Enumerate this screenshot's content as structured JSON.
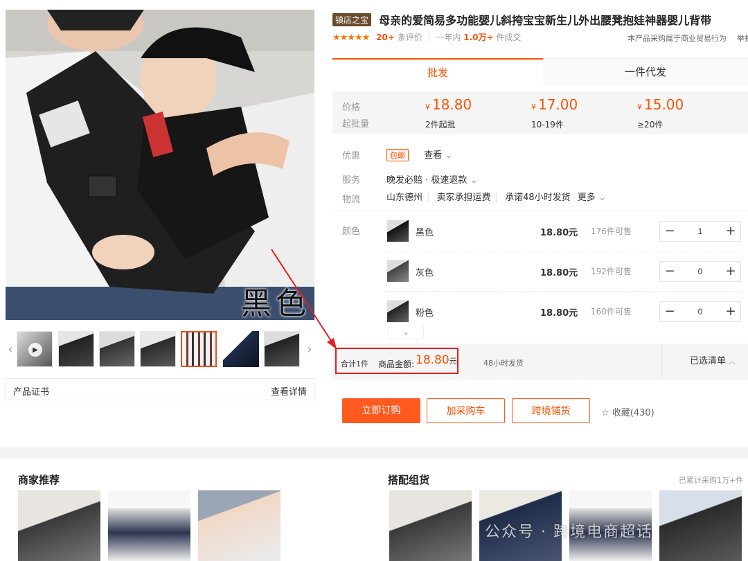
{
  "gallery": {
    "main_caption": "黑色",
    "prev_icon": "chevron-left-icon",
    "next_icon": "chevron-right-icon"
  },
  "certificate": {
    "label": "产品证书",
    "link": "查看详情"
  },
  "product": {
    "store_badge": "镇店之宝",
    "title": "母亲的爱简易多功能婴儿斜挎宝宝新生儿外出腰凳抱娃神器婴儿背带",
    "stars": "★★★★★",
    "review_count": "20+",
    "review_label": "条评价",
    "sales_prefix": "一年内",
    "sales_count": "1.0万+",
    "sales_label": "件成交",
    "trade_note": "本产品采购属于商业贸易行为",
    "report": "举报"
  },
  "tabs": [
    {
      "label": "批发"
    },
    {
      "label": "一件代发"
    }
  ],
  "pricing": {
    "price_label": "价格",
    "moq_label": "起批量",
    "currency": "¥",
    "tiers": [
      {
        "price": "18.80",
        "qty": "2件起批"
      },
      {
        "price": "17.00",
        "qty": "10-19件"
      },
      {
        "price": "15.00",
        "qty": "≥20件"
      }
    ]
  },
  "attrs": {
    "promo_label": "优惠",
    "promo_tag": "包邮",
    "promo_view": "查看",
    "service_label": "服务",
    "service_value": "晚发必赔 · 极速退款",
    "logistics_label": "物流",
    "origin": "山东德州",
    "freight": "卖家承担运费",
    "promise": "承诺48小时发货",
    "more": "更多",
    "color_label": "颜色"
  },
  "skus": [
    {
      "name": "黑色",
      "price": "18.80元",
      "stock": "176件可售",
      "qty": "1"
    },
    {
      "name": "灰色",
      "price": "18.80元",
      "stock": "192件可售",
      "qty": "0"
    },
    {
      "name": "粉色",
      "price": "18.80元",
      "stock": "160件可售",
      "qty": "0"
    }
  ],
  "summary": {
    "count": "合计1件",
    "amount_label": "商品金额:",
    "amount": "18.80",
    "unit": "元",
    "ship": "48小时发货",
    "selected": "已选清单"
  },
  "actions": {
    "order": "立即订购",
    "cart": "加采购车",
    "cross": "跨境铺货",
    "favorite": "收藏(430)"
  },
  "sections": {
    "merchant_title": "商家推荐",
    "bundle_title": "搭配组货",
    "bundle_note": "已累计采购1万+件",
    "watermark": "公众号 · 跨境电商超话"
  },
  "colors": {
    "accent": "#ff5000",
    "highlight_box": "#e02020",
    "store_badge": "#6a4b2c"
  }
}
